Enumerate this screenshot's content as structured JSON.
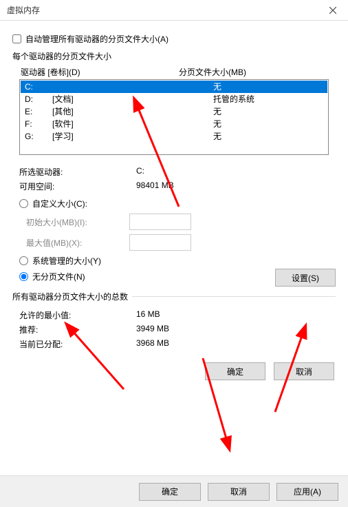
{
  "window": {
    "title": "虚拟内存"
  },
  "auto_manage": {
    "label": "自动管理所有驱动器的分页文件大小(A)",
    "checked": false
  },
  "drive_section": {
    "title": "每个驱动器的分页文件大小",
    "col_drive": "驱动器 [卷标](D)",
    "col_size": "分页文件大小(MB)",
    "rows": [
      {
        "letter": "C:",
        "label": "",
        "size": "无",
        "selected": true
      },
      {
        "letter": "D:",
        "label": "[文档]",
        "size": "托管的系统",
        "selected": false
      },
      {
        "letter": "E:",
        "label": "[其他]",
        "size": "无",
        "selected": false
      },
      {
        "letter": "F:",
        "label": "[软件]",
        "size": "无",
        "selected": false
      },
      {
        "letter": "G:",
        "label": "[学习]",
        "size": "无",
        "selected": false
      }
    ],
    "selected_label": "所选驱动器:",
    "selected_value": "C:",
    "free_label": "可用空间:",
    "free_value": "98401 MB"
  },
  "size_mode": {
    "custom_label": "自定义大小(C):",
    "initial_label": "初始大小(MB)(I):",
    "initial_value": "",
    "max_label": "最大值(MB)(X):",
    "max_value": "",
    "system_label": "系统管理的大小(Y)",
    "none_label": "无分页文件(N)",
    "selected": "none",
    "set_button": "设置(S)"
  },
  "totals": {
    "title": "所有驱动器分页文件大小的总数",
    "min_label": "允许的最小值:",
    "min_value": "16 MB",
    "rec_label": "推荐:",
    "rec_value": "3949 MB",
    "cur_label": "当前已分配:",
    "cur_value": "3968 MB"
  },
  "buttons": {
    "ok": "确定",
    "cancel": "取消",
    "apply": "应用(A)"
  }
}
